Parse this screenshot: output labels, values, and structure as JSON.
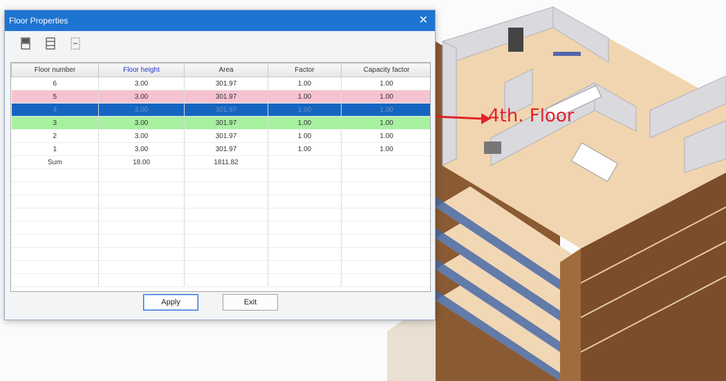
{
  "dialog": {
    "title": "Floor Properties",
    "close_glyph": "✕",
    "toolbar": [
      "insert-floor-above-icon",
      "insert-floor-below-icon",
      "delete-floor-icon"
    ],
    "columns": [
      "Floor number",
      "Floor height",
      "Area",
      "Factor",
      "Capacity factor"
    ],
    "rows": [
      {
        "floor": "6",
        "height": "3.00",
        "area": "301.97",
        "factor": "1.00",
        "capacity": "1.00"
      },
      {
        "floor": "5",
        "height": "3.00",
        "area": "301.97",
        "factor": "1.00",
        "capacity": "1.00"
      },
      {
        "floor": "4",
        "height": "3.00",
        "area": "301.97",
        "factor": "1.00",
        "capacity": "1.00"
      },
      {
        "floor": "3",
        "height": "3.00",
        "area": "301.97",
        "factor": "1.00",
        "capacity": "1.00"
      },
      {
        "floor": "2",
        "height": "3.00",
        "area": "301.97",
        "factor": "1.00",
        "capacity": "1.00"
      },
      {
        "floor": "1",
        "height": "3.00",
        "area": "301.97",
        "factor": "1.00",
        "capacity": "1.00"
      }
    ],
    "sum": {
      "label": "Sum",
      "height": "18.00",
      "area": "1811.82"
    },
    "apply_label": "Apply",
    "exit_label": "Exit"
  },
  "annotation": {
    "text": "4th. Floor",
    "color": "#e0232a"
  },
  "colors": {
    "title_bar": "#1e74d2",
    "row_pink": "#f5c2d0",
    "row_selected": "#1565c0",
    "row_green": "#a7f0a0"
  }
}
